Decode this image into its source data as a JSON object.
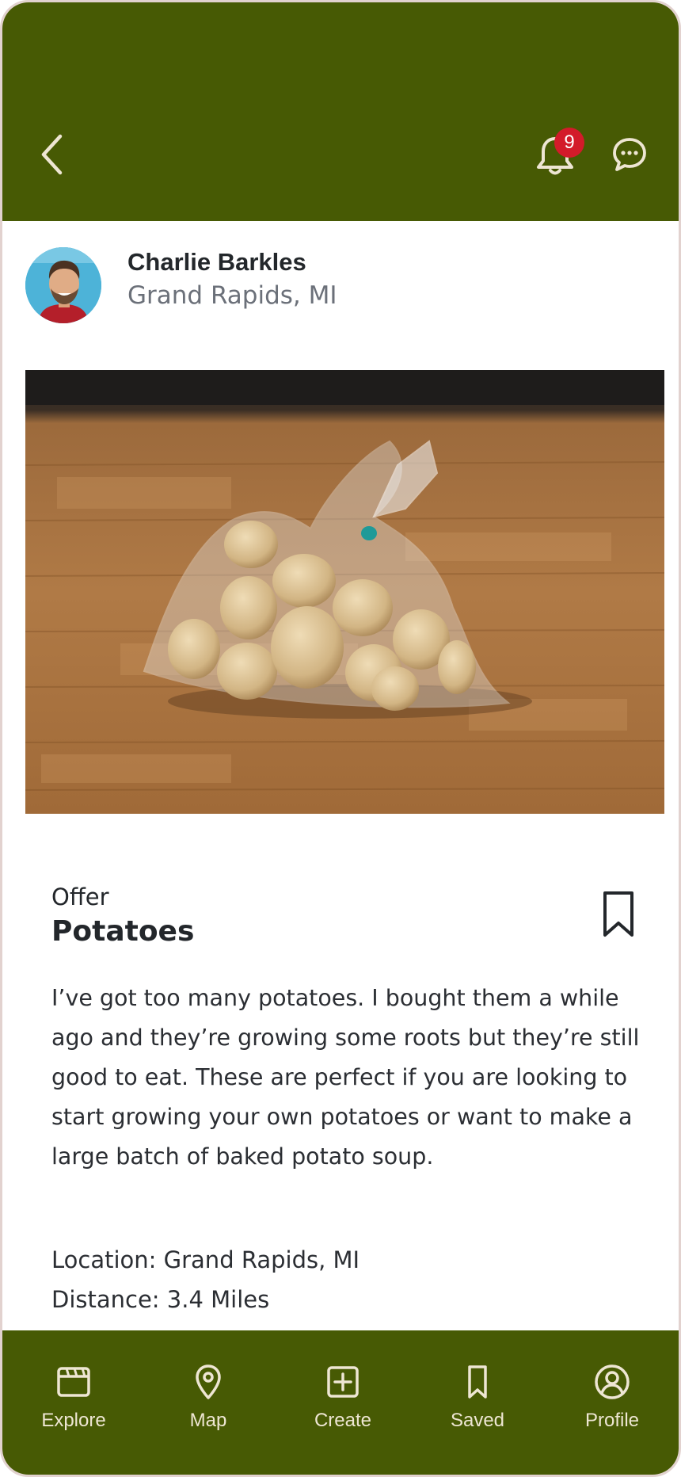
{
  "header": {
    "notification_count": "9",
    "back_icon": "chevron-left-icon",
    "bell_icon": "bell-icon",
    "chat_icon": "chat-bubble-icon",
    "background_color": "#475a04"
  },
  "author": {
    "name": "Charlie Barkles",
    "location": "Grand Rapids, MI"
  },
  "post": {
    "type": "Offer",
    "title": "Potatoes",
    "description": "I’ve got too many potatoes. I bought them a while ago and they’re growing some roots but they’re still good to eat. These are perfect if you are looking to start growing your own potatoes or want to make a large batch of baked potato soup.",
    "location_line": "Location: Grand Rapids, MI",
    "distance_line": "Distance: 3.4 Miles"
  },
  "nav": {
    "items": [
      {
        "label": "Explore",
        "icon": "clapperboard-icon"
      },
      {
        "label": "Map",
        "icon": "map-pin-icon"
      },
      {
        "label": "Create",
        "icon": "plus-square-icon"
      },
      {
        "label": "Saved",
        "icon": "bookmark-icon"
      },
      {
        "label": "Profile",
        "icon": "user-circle-icon"
      }
    ]
  },
  "colors": {
    "accent": "#475a04",
    "badge": "#d31b2a",
    "nav_text": "#eee6d3"
  }
}
